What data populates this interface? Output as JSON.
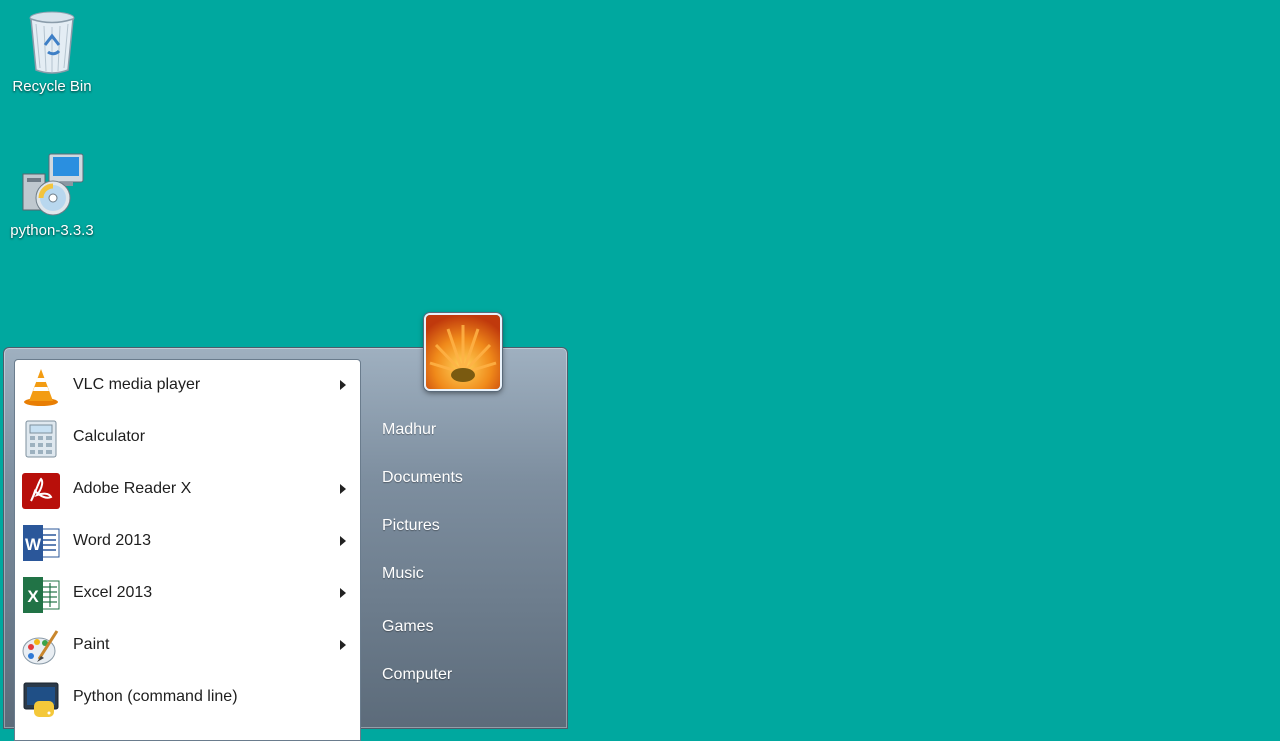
{
  "desktop": {
    "icons": [
      {
        "label": "Recycle Bin",
        "icon": "recycle-bin-icon"
      },
      {
        "label": "python-3.3.3",
        "icon": "installer-icon"
      }
    ]
  },
  "start_menu": {
    "programs": [
      {
        "label": "VLC media player",
        "icon": "vlc-icon",
        "submenu": true
      },
      {
        "label": "Calculator",
        "icon": "calculator-icon",
        "submenu": false
      },
      {
        "label": "Adobe Reader X",
        "icon": "adobe-reader-icon",
        "submenu": true
      },
      {
        "label": "Word 2013",
        "icon": "word-icon",
        "submenu": true
      },
      {
        "label": "Excel 2013",
        "icon": "excel-icon",
        "submenu": true
      },
      {
        "label": "Paint",
        "icon": "paint-icon",
        "submenu": true
      },
      {
        "label": "Python (command line)",
        "icon": "python-icon",
        "submenu": false
      }
    ],
    "places": [
      "Madhur",
      "Documents",
      "Pictures",
      "Music",
      "Games",
      "Computer"
    ]
  },
  "colors": {
    "desktop_background": "#00a89f",
    "menu_right_pane": "#7d8e9f"
  }
}
